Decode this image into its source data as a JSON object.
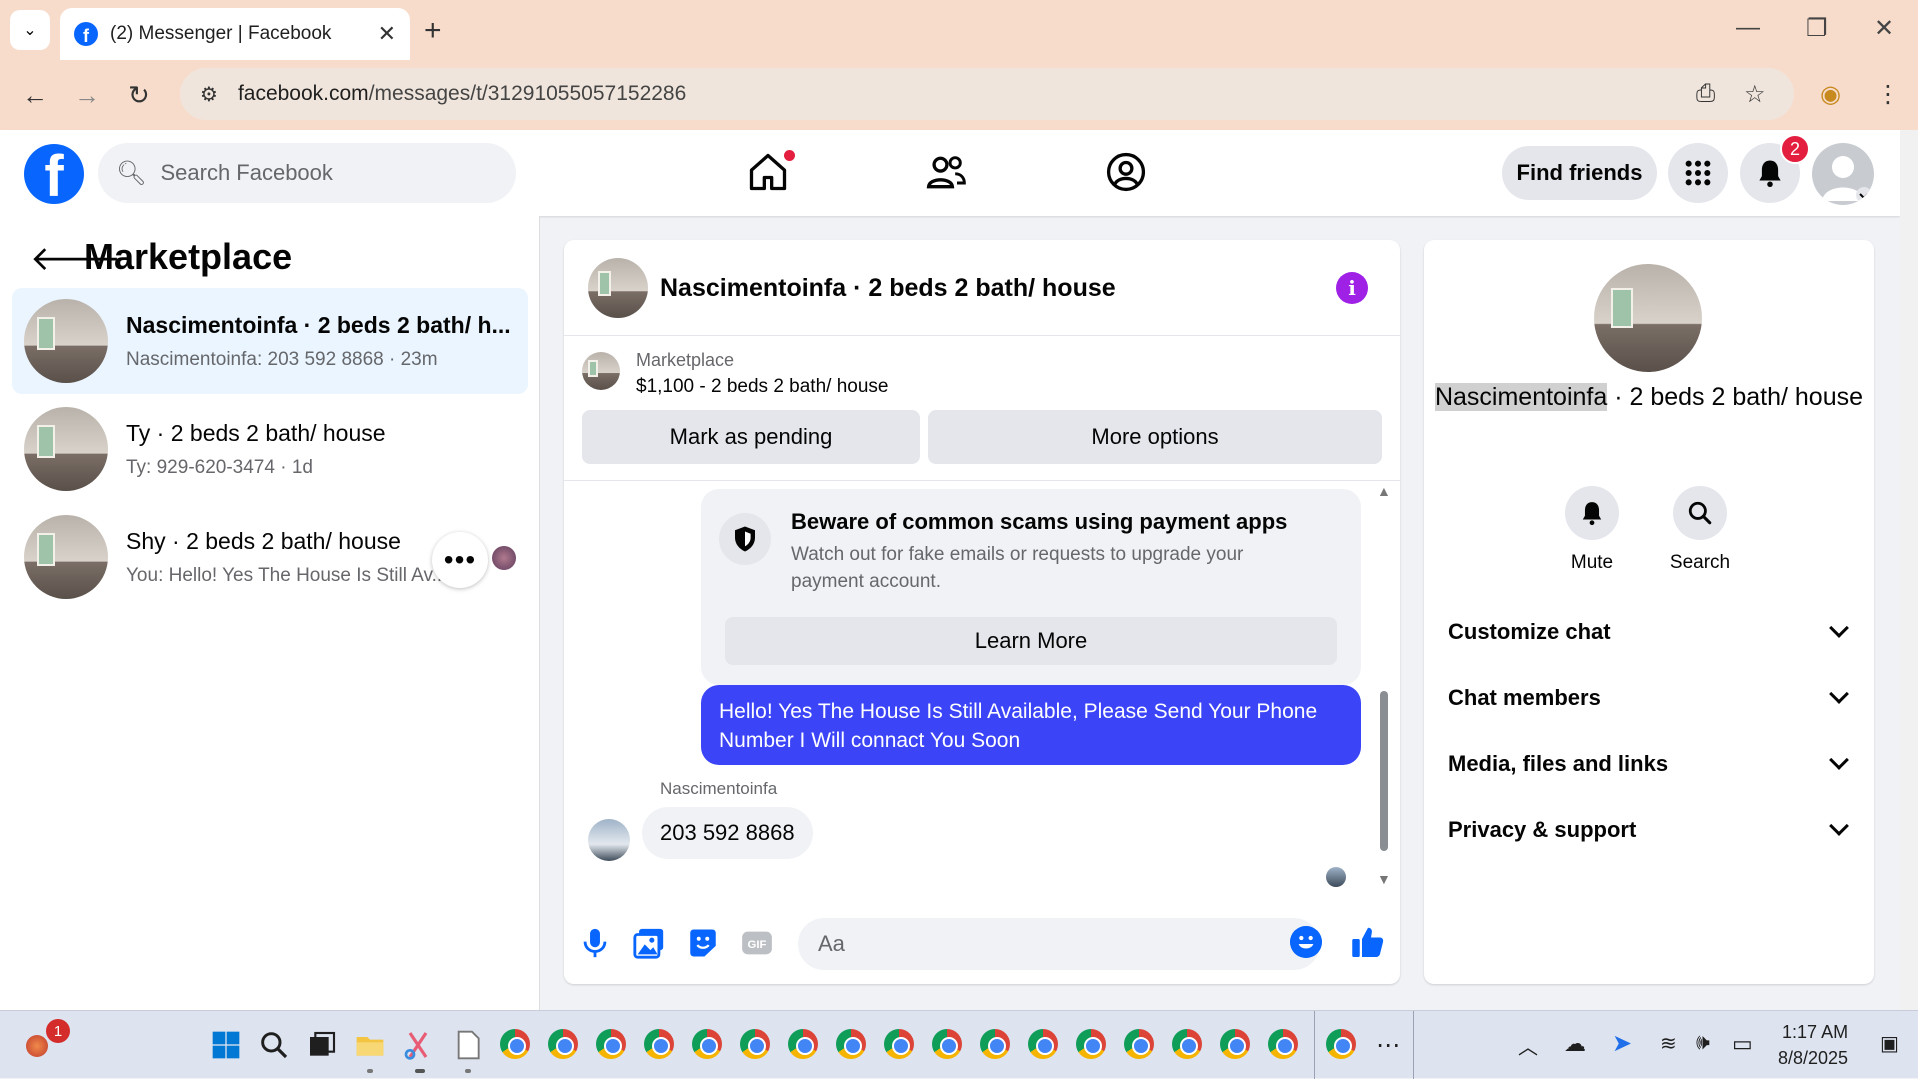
{
  "browser": {
    "tab_title": "(2) Messenger | Facebook",
    "url_domain": "facebook.com",
    "url_path": "/messages/t/31291055057152286"
  },
  "fb": {
    "search_placeholder": "Search Facebook",
    "find_friends": "Find friends",
    "notif_count": "2"
  },
  "left": {
    "title": "Marketplace",
    "conversations": [
      {
        "name": "Nascimentoinfa · 2 beds 2 bath/ h...",
        "sub": "Nascimentoinfa: 203 592 8868 · 23m"
      },
      {
        "name": "Ty · 2 beds 2 bath/ house",
        "sub": "Ty: 929-620-3474 · 1d"
      },
      {
        "name": "Shy · 2 beds 2 bath/ house",
        "sub": "You: Hello! Yes The House Is Still Av..."
      }
    ]
  },
  "chat": {
    "title": "Nascimentoinfa · 2 beds 2 bath/ house",
    "marketplace_label": "Marketplace",
    "listing": "$1,100 - 2 beds 2 bath/ house",
    "mark_pending": "Mark as pending",
    "more_options": "More options",
    "scam_title": "Beware of common scams using payment apps",
    "scam_body": "Watch out for fake emails or requests to upgrade your payment account.",
    "learn_more": "Learn More",
    "my_message": "Hello! Yes The House  Is Still Available, Please Send Your Phone Number I Will connact You Soon",
    "sender": "Nascimentoinfa",
    "their_message": "203 592 8868",
    "input_placeholder": "Aa"
  },
  "right": {
    "name_highlight": "Nascimentoinfa",
    "name_rest": " · 2 beds 2 bath/ house",
    "mute": "Mute",
    "search": "Search",
    "sections": [
      "Customize chat",
      "Chat members",
      "Media, files and links",
      "Privacy & support"
    ]
  },
  "taskbar": {
    "time": "1:17 AM",
    "date": "8/8/2025",
    "app_badge": "1"
  },
  "colors": {
    "fb_blue": "#0866ff",
    "bubble_mine": "#3b44f6",
    "info_purple": "#a021e6",
    "notif_red": "#e41e3f"
  }
}
